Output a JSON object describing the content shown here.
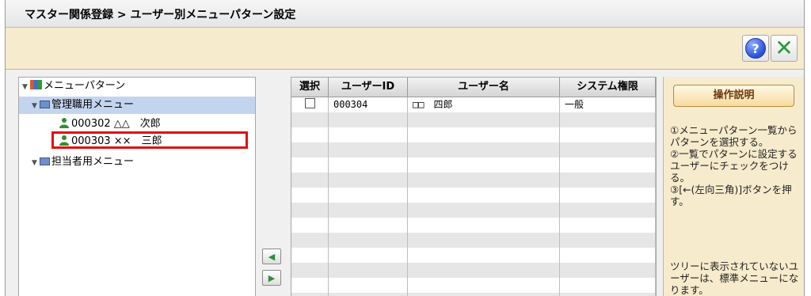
{
  "header": {
    "breadcrumb": "マスター関係登録 > ユーザー別メニューパターン設定"
  },
  "toolbar": {
    "help_icon": "help-icon",
    "close_icon": "close-icon",
    "help_glyph": "?",
    "close_glyph": "✕"
  },
  "tree": {
    "root_label": "メニューパターン",
    "groups": [
      {
        "label": "管理職用メニュー",
        "selected": true,
        "users": [
          {
            "id": "000302",
            "name": "△△　次郎"
          },
          {
            "id": "000303",
            "name": "××　三郎",
            "highlighted": true
          }
        ]
      },
      {
        "label": "担当者用メニュー",
        "selected": false,
        "users": []
      }
    ]
  },
  "arrows": {
    "left_glyph": "◀",
    "right_glyph": "▶"
  },
  "grid": {
    "columns": [
      "選択",
      "ユーザーID",
      "ユーザー名",
      "システム権限"
    ],
    "rows": [
      {
        "checked": false,
        "user_id": "000304",
        "user_name": "□□　四郎",
        "authority": "一般"
      }
    ]
  },
  "explanation": {
    "button_label": "操作説明",
    "steps": "①メニューパターン一覧からパターンを選択する。\n②一覧でパターンに設定するユーザーにチェックをつける。\n③[←(左向三角)]ボタンを押す。",
    "note": "ツリーに表示されていないユーザーは、標準メニューになります。"
  }
}
